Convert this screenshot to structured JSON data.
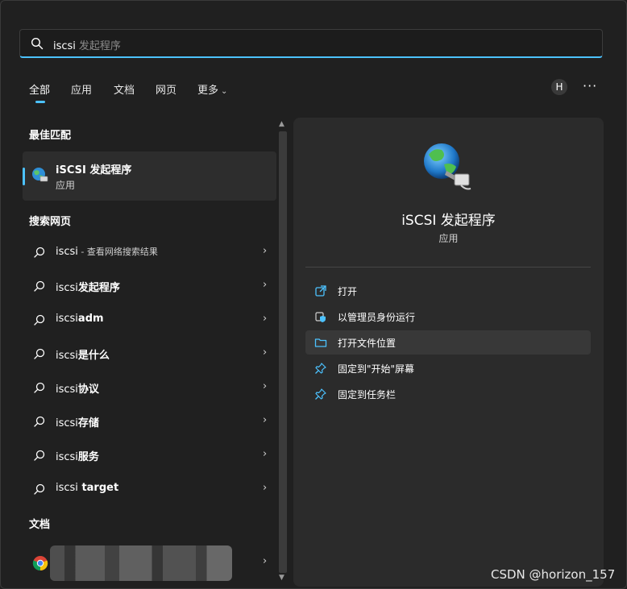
{
  "search": {
    "query": "iscsi",
    "hint": "发起程序"
  },
  "tabs": [
    {
      "label": "全部"
    },
    {
      "label": "应用"
    },
    {
      "label": "文档"
    },
    {
      "label": "网页"
    },
    {
      "label": "更多"
    }
  ],
  "user_avatar": "H",
  "more_options": "···",
  "best_match": {
    "section_title": "最佳匹配",
    "title": "iSCSI 发起程序",
    "subtitle": "应用"
  },
  "web_search": {
    "section_title": "搜索网页",
    "items": [
      {
        "prefix": "iscsi",
        "suffix": " - 查看网络搜索结果",
        "suffix_bold": false
      },
      {
        "prefix": "iscsi",
        "suffix": "发起程序",
        "suffix_bold": true
      },
      {
        "prefix": "iscsi",
        "suffix": "adm",
        "suffix_bold": true
      },
      {
        "prefix": "iscsi",
        "suffix": "是什么",
        "suffix_bold": true
      },
      {
        "prefix": "iscsi",
        "suffix": "协议",
        "suffix_bold": true
      },
      {
        "prefix": "iscsi",
        "suffix": "存储",
        "suffix_bold": true
      },
      {
        "prefix": "iscsi",
        "suffix": "服务",
        "suffix_bold": true
      },
      {
        "prefix": "iscsi",
        "suffix": " target",
        "suffix_bold": true
      }
    ]
  },
  "documents": {
    "section_title": "文档"
  },
  "detail": {
    "app_name": "iSCSI 发起程序",
    "app_type": "应用",
    "actions": [
      {
        "label": "打开",
        "icon": "open-external-icon"
      },
      {
        "label": "以管理员身份运行",
        "icon": "shield-admin-icon"
      },
      {
        "label": "打开文件位置",
        "icon": "folder-icon"
      },
      {
        "label": "固定到\"开始\"屏幕",
        "icon": "pin-icon"
      },
      {
        "label": "固定到任务栏",
        "icon": "pin-icon"
      }
    ]
  },
  "watermark": "CSDN @horizon_157",
  "colors": {
    "accent": "#4cc2ff",
    "background": "#202020",
    "panel": "#2b2b2b"
  }
}
